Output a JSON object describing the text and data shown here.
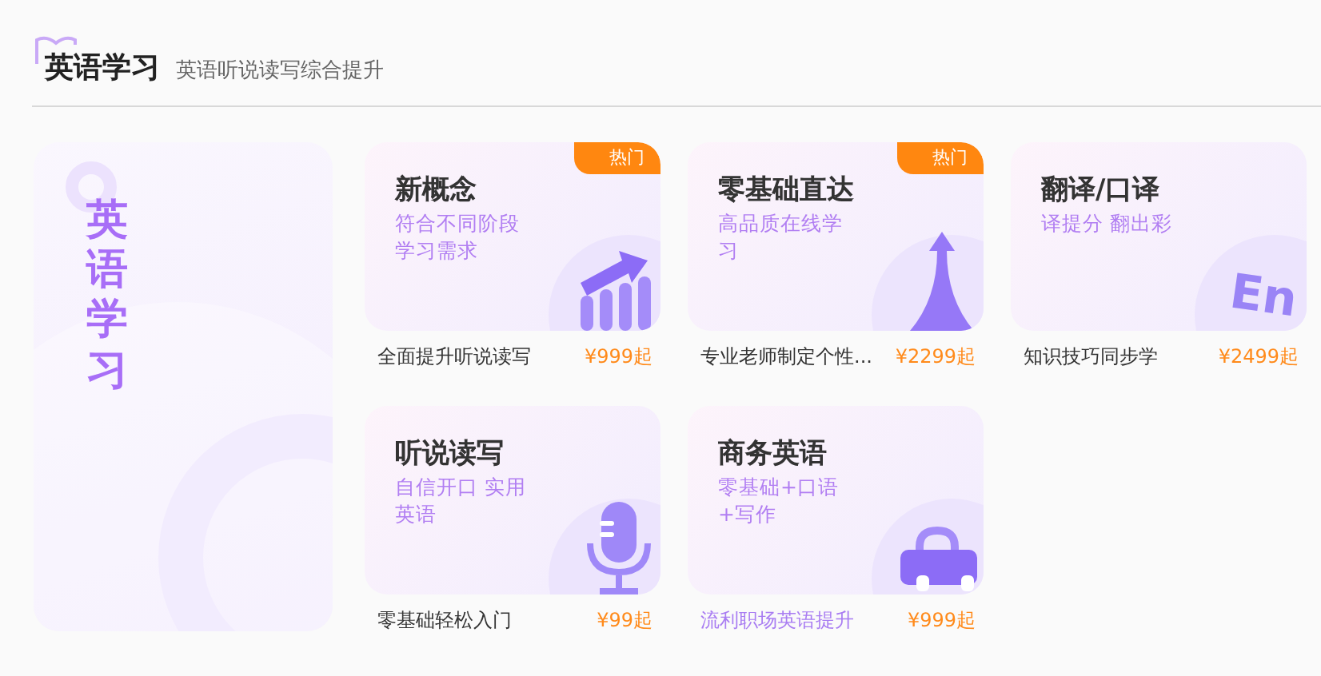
{
  "header": {
    "title": "英语学习",
    "subtitle": "英语听说读写综合提升"
  },
  "banner": {
    "title": "英语学习"
  },
  "courses": [
    {
      "title": "新概念",
      "subtitle": "符合不同阶段学习需求",
      "badge": "热门",
      "kind": "chart",
      "caption": "全面提升听说读写",
      "price": "¥999起",
      "hovered": false
    },
    {
      "title": "零基础直达",
      "subtitle": "高品质在线学习",
      "badge": "热门",
      "kind": "arrow",
      "caption": "专业老师制定个性...",
      "price": "¥2299起",
      "hovered": false
    },
    {
      "title": "翻译/口译",
      "subtitle": "译提分 翻出彩",
      "kind": "letters",
      "icon_text": "En",
      "caption": "知识技巧同步学",
      "price": "¥2499起",
      "hovered": false
    },
    {
      "title": "听说读写",
      "subtitle": "自信开口 实用英语",
      "kind": "mic",
      "caption": "零基础轻松入门",
      "price": "¥99起",
      "hovered": false
    },
    {
      "title": "商务英语",
      "subtitle": "零基础+口语+写作",
      "kind": "bag",
      "caption": "流利职场英语提升",
      "price": "¥999起",
      "hovered": true
    }
  ]
}
